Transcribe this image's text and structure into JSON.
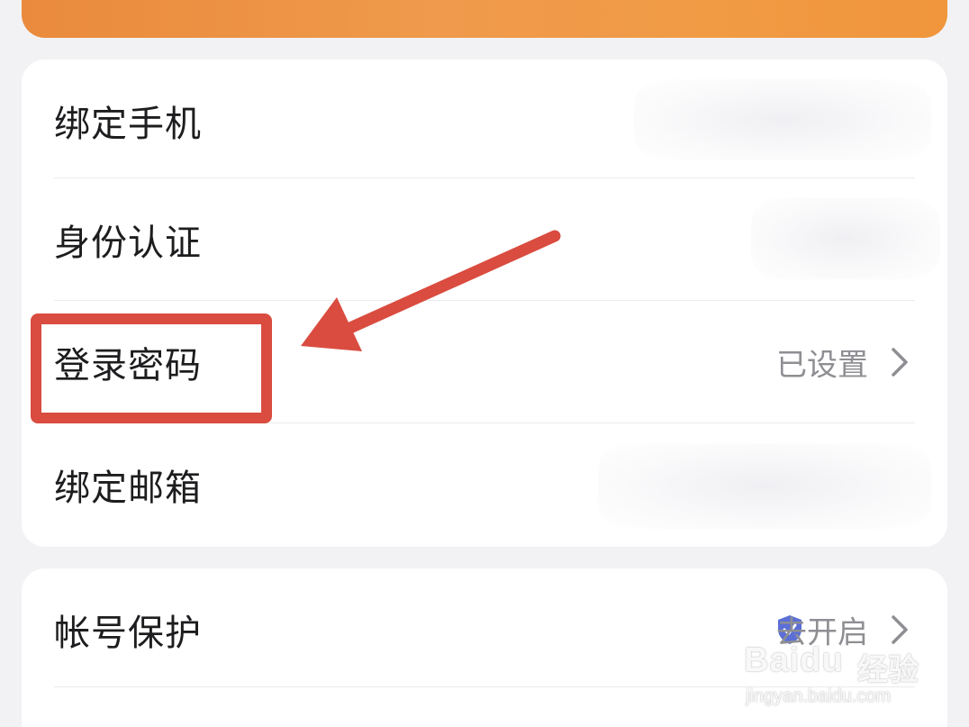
{
  "card1": {
    "rows": [
      {
        "label": "绑定手机"
      },
      {
        "label": "身份认证"
      },
      {
        "label": "登录密码",
        "value": "已设置"
      },
      {
        "label": "绑定邮箱"
      }
    ]
  },
  "card2": {
    "rows": [
      {
        "label": "帐号保护",
        "value": "去开启"
      }
    ]
  },
  "watermark": {
    "brand": "Baidu",
    "cn": "经验",
    "url": "jingyan.baidu.com"
  },
  "colors": {
    "accent_orange": "#ef9a4c",
    "annotation_red": "#d94c3f",
    "shield_blue": "#5b6fd6",
    "value_gray": "#8e8e93"
  },
  "icons": [
    "chevron-right-icon",
    "shield-check-icon"
  ]
}
